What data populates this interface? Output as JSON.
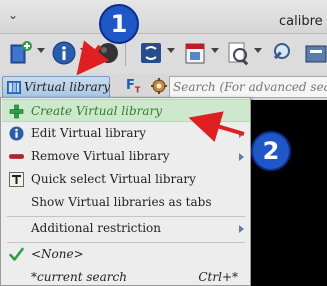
{
  "window": {
    "title": "calibre -",
    "caret": "⌄",
    "dash": "-"
  },
  "toolbar": {
    "icons": [
      "add-books-icon",
      "book-details-icon",
      "remove-icon",
      "convert-icon",
      "calendar-icon",
      "view-icon",
      "search-icon"
    ]
  },
  "search_row": {
    "virtual_library_label": "Virtual library",
    "ft_label": "F",
    "ft_sub": "T",
    "search_placeholder": "Search (For advanced search"
  },
  "menu": {
    "items": [
      {
        "label": "Create Virtual library",
        "icon": "plus-icon",
        "highlighted": true,
        "submenu": false
      },
      {
        "label": "Edit Virtual library",
        "icon": "info-icon",
        "submenu": true
      },
      {
        "label": "Remove Virtual library",
        "icon": "minus-icon",
        "submenu": true
      },
      {
        "label": "Quick select Virtual library",
        "icon": "text-t-icon",
        "submenu": false
      },
      {
        "label": "Show Virtual libraries as tabs",
        "icon": "",
        "submenu": false
      },
      {
        "label": "Additional restriction",
        "icon": "",
        "submenu": true
      },
      {
        "label": "<None>",
        "icon": "checkmark-icon",
        "submenu": false
      },
      {
        "label": "*current search",
        "icon": "",
        "shortcut": "Ctrl+*",
        "submenu": false
      }
    ]
  },
  "annotations": {
    "badge1": "1",
    "badge2": "2",
    "accent_color": "#1f57c8",
    "arrow_color": "#e02020"
  },
  "colors": {
    "highlight": "#cde8cd",
    "menu_bg": "#ededed",
    "vl_button": "#b3cde6"
  }
}
